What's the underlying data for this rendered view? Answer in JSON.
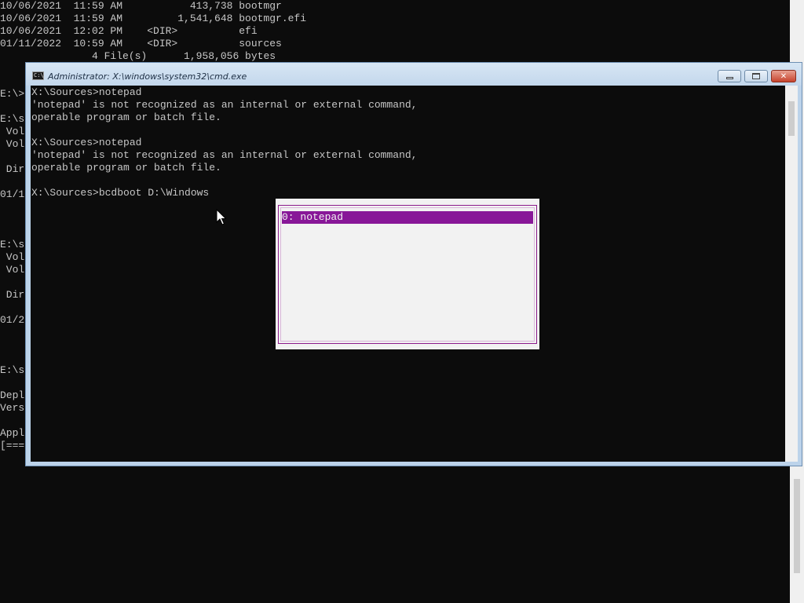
{
  "background_console": {
    "lines": [
      "10/06/2021  11:59 AM           413,738 bootmgr",
      "10/06/2021  11:59 AM         1,541,648 bootmgr.efi",
      "10/06/2021  12:02 PM    <DIR>          efi",
      "01/11/2022  10:59 AM    <DIR>          sources",
      "               4 File(s)      1,958,056 bytes",
      "",
      "",
      "E:\\>",
      "",
      "E:\\s",
      " Vol",
      " Vol",
      "",
      " Dir",
      "",
      "01/1",
      "",
      "",
      "",
      "E:\\s",
      " Vol",
      " Vol",
      "",
      " Dir",
      "",
      "01/2",
      "",
      "",
      "",
      "E:\\s",
      "",
      "Depl",
      "Vers",
      "",
      "Appl",
      "[==="
    ]
  },
  "window": {
    "title": "Administrator: X:\\windows\\system32\\cmd.exe",
    "icon_label": "C:\\",
    "close_glyph": "✕"
  },
  "console": {
    "lines": [
      "X:\\Sources>notepad",
      "'notepad' is not recognized as an internal or external command,",
      "operable program or batch file.",
      "",
      "X:\\Sources>notepad",
      "'notepad' is not recognized as an internal or external command,",
      "operable program or batch file.",
      "",
      "X:\\Sources>bcdboot D:\\Windows"
    ]
  },
  "history_popup": {
    "items": [
      "0: notepad"
    ],
    "selected_index": 0
  },
  "colors": {
    "console_bg": "#0c0c0c",
    "console_fg": "#c7c7c7",
    "popup_bg": "#f2f2f2",
    "popup_accent": "#881798"
  },
  "icons": {
    "window_icon": "cmd-window-icon",
    "minimize": "minimize-icon",
    "maximize": "maximize-icon",
    "close": "close-icon",
    "pointer": "mouse-pointer-icon"
  }
}
